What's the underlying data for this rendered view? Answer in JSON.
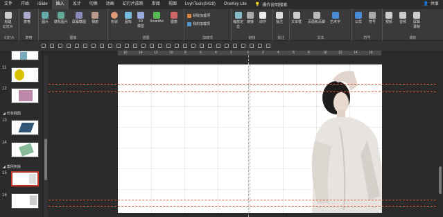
{
  "tabs": [
    "文件",
    "开始",
    "iSlide",
    "插入",
    "设计",
    "切换",
    "动画",
    "幻灯片放映",
    "审阅",
    "视图",
    "LvyhTools(0429)",
    "OneKey Lite"
  ],
  "active_tab": "插入",
  "search_label": "操作说明搜索",
  "share_label": "共享",
  "ribbon": {
    "new_slide": "新建\n幻灯片",
    "table": "表格",
    "image": "图片",
    "online_image": "联机图片",
    "screenshot": "屏幕截图",
    "album": "相册",
    "shape": "形状",
    "icon": "图标",
    "model3d": "3D\n模型",
    "smartart": "SmartArt",
    "chart": "图表",
    "get_addins": "获取加载项",
    "my_addins": "我的加载项",
    "zoom": "缩放定\n位",
    "link": "链接",
    "action": "动作",
    "comment": "批注",
    "textbox": "文本框",
    "header_footer": "页眉和页脚",
    "wordart": "艺术字",
    "equation": "公式",
    "symbol": "符号",
    "video": "视频",
    "audio": "音频",
    "screen_record": "屏幕\n录制",
    "groups": {
      "slides": "幻灯片",
      "tables": "表格",
      "images": "图像",
      "illustrations": "插图",
      "addins": "加载项",
      "links": "链接",
      "comments": "批注",
      "text": "文本",
      "symbols": "符号",
      "media": "媒体"
    }
  },
  "ruler_marks": [
    "16",
    "14",
    "12",
    "10",
    "8",
    "6",
    "4",
    "2",
    "0",
    "2",
    "4",
    "6",
    "8",
    "10",
    "12",
    "14",
    "16"
  ],
  "thumb_pane": {
    "items": [
      {
        "num": "11"
      },
      {
        "num": "12"
      },
      {
        "section": "形状截图"
      },
      {
        "num": "13"
      },
      {
        "num": "14"
      },
      {
        "section": "案例实操"
      },
      {
        "num": "15"
      },
      {
        "num": "16"
      }
    ],
    "section_1": "形状截图",
    "section_2": "案例实操"
  },
  "colors": {
    "accent": "#c0392b",
    "guide": "#d05a3a",
    "ribbon_bg": "#3a3a3a",
    "window_bg": "#2b2b2b"
  }
}
